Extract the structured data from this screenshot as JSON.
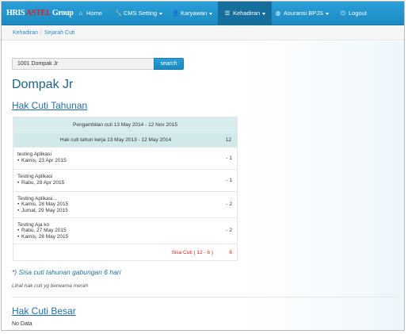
{
  "brand": {
    "part1": "HRIS ",
    "part2": "ASTEL",
    "part3": " Group"
  },
  "nav": {
    "home": "Home",
    "cms": "CMS Setting",
    "karyawan": "Karyawan",
    "kehadiran": "Kehadiran",
    "bpjs": "Asuransi BPJS",
    "logout": "Logout"
  },
  "breadcrumb": {
    "parent": "Kehadiran",
    "current": "Sejarah Cuti"
  },
  "search": {
    "value": "1001 Dompak Jr",
    "button": "search"
  },
  "person": {
    "name": "Dompak Jr"
  },
  "annual": {
    "heading": "Hak Cuti Tahunan",
    "period": "Pengambilan cuti 13 May 2014 - 12 Nov 2015",
    "entitlement_label": "Hak cuti tahun kerja 13 May 2013 - 12 May 2014",
    "entitlement_value": "12",
    "rows": [
      {
        "title": "testing Aplikasi",
        "dates": [
          "Kamis, 23 Apr 2015"
        ],
        "value": "- 1"
      },
      {
        "title": "Testing Aplikasi",
        "dates": [
          "Rabu, 29 Apr 2015"
        ],
        "value": "- 1"
      },
      {
        "title": "Testing Aplikasi...",
        "dates": [
          "Kamis, 28 May 2015",
          "Jumat, 29 May 2015"
        ],
        "value": "- 2"
      },
      {
        "title": "Testing Aja ko",
        "dates": [
          "Rabu, 27 May 2015",
          "Kamis, 28 May 2015"
        ],
        "value": "- 2"
      }
    ],
    "sisa_label": "Sisa Cuti ( 12 - 6 )",
    "sisa_value": "6"
  },
  "notes": {
    "combined": "*) Sisa cuti tahunan gabungan 6 hari",
    "red_hint": "Lihat hak cuti yg berwarna merah"
  },
  "big": {
    "heading": "Hak Cuti Besar",
    "empty": "No Data"
  }
}
